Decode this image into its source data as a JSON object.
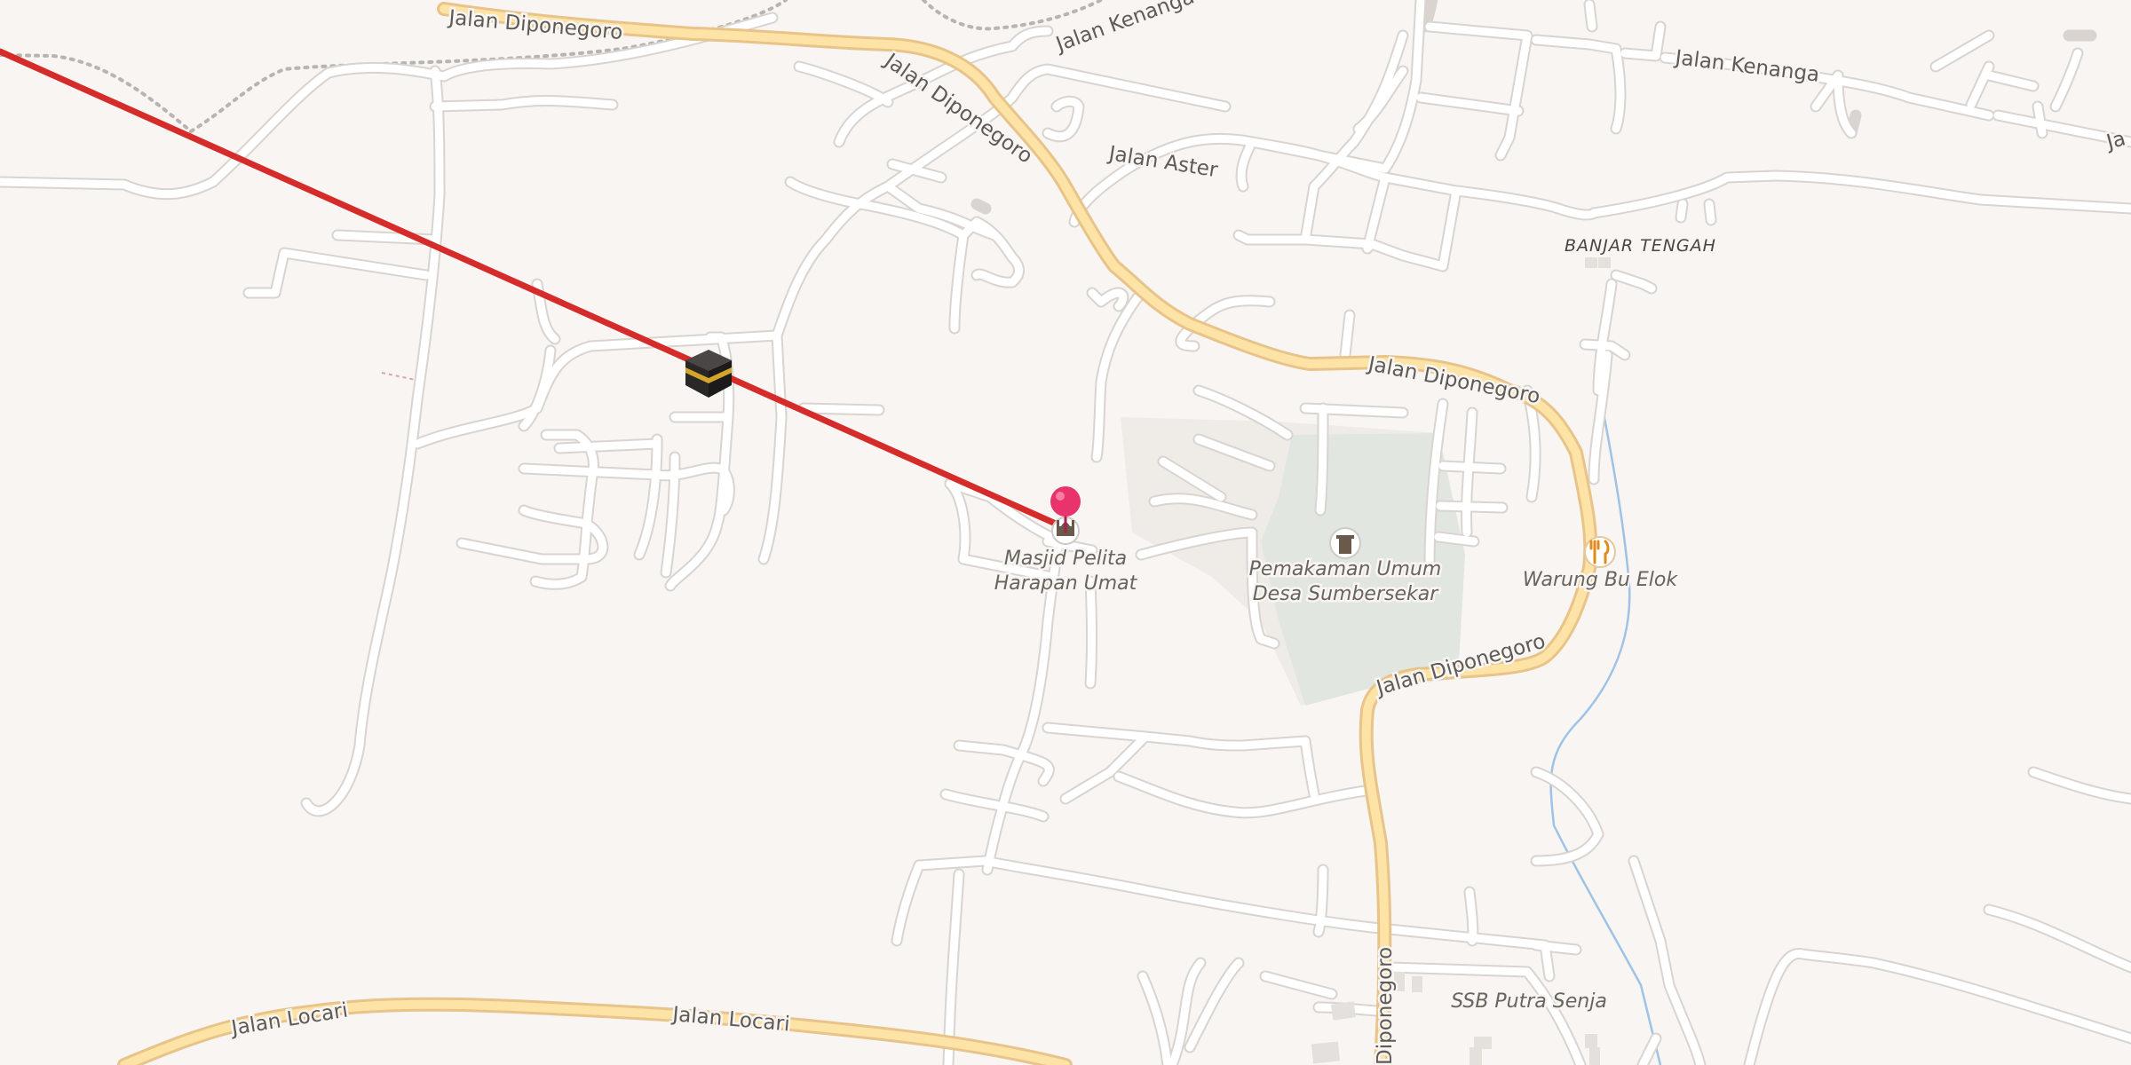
{
  "map": {
    "colors": {
      "background": "#f8f5f2",
      "minor_road": "#ffffff",
      "main_road": "#fde3a5",
      "cemetery": "#e2e6e0",
      "stream": "#9ec3e6",
      "route_line": "#d62b2b",
      "pin": "#e8336c"
    },
    "streets": {
      "diponegoro_nw": "Jalan Diponegoro",
      "diponegoro_n": "Jalan Diponegoro",
      "diponegoro_e": "Jalan Diponegoro",
      "diponegoro_se": "Jalan Diponegoro",
      "diponegoro_s": "Diponegoro",
      "kenanga_w": "Jalan Kenanga",
      "kenanga_e": "Jalan Kenanga",
      "kenanga_edge": "Ja",
      "aster": "Jalan Aster",
      "locari_w": "Jalan Locari",
      "locari_e": "Jalan Locari"
    },
    "places": {
      "banjar_tengah": "BANJAR TENGAH"
    },
    "pois": {
      "mosque": {
        "name_line1": "Masjid Pelita",
        "name_line2": "Harapan Umat",
        "icon": "mosque-icon"
      },
      "cemetery": {
        "name_line1": "Pemakaman Umum",
        "name_line2": "Desa Sumbersekar",
        "icon": "grave-icon"
      },
      "restaurant": {
        "name": "Warung Bu Elok",
        "icon": "fork-knife-icon"
      },
      "school": {
        "name": "SSB Putra Senja"
      }
    },
    "markers": {
      "kaaba": {
        "icon": "kaaba-icon"
      },
      "pin": {
        "icon": "location-pin-icon"
      }
    }
  }
}
